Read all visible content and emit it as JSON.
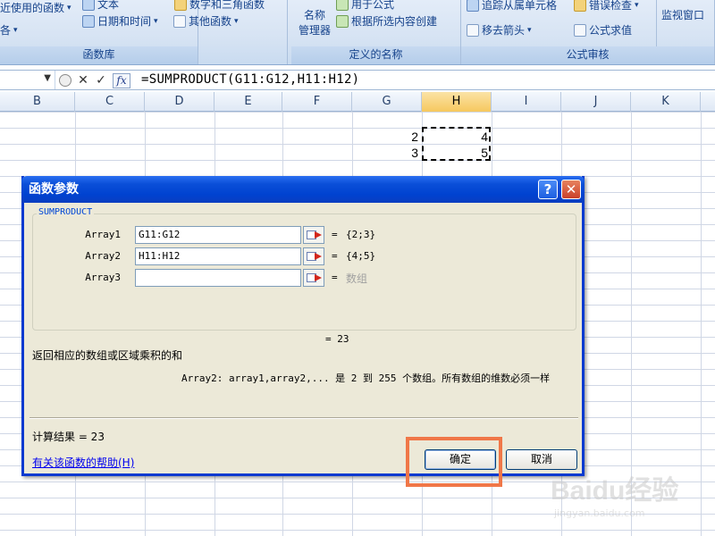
{
  "ribbon": {
    "groups": [
      {
        "label": "函数库",
        "items": [
          "近使用的函数",
          "文本",
          "日期和时间",
          "数字和三角函数",
          "其他函数",
          "各"
        ]
      },
      {
        "label": "定义的名称",
        "items": [
          "名称",
          "管理器",
          "用于公式",
          "根据所选内容创建"
        ]
      },
      {
        "label": "公式审核",
        "items": [
          "追踪从属单元格",
          "错误检查",
          "移去箭头",
          "公式求值"
        ]
      },
      {
        "label": "",
        "items": [
          "监视窗口"
        ]
      }
    ]
  },
  "formula_bar": {
    "formula": "=SUMPRODUCT(G11:G12,H11:H12)",
    "fx_label": "fx"
  },
  "columns": [
    "B",
    "C",
    "D",
    "E",
    "F",
    "G",
    "H",
    "I",
    "J",
    "K"
  ],
  "cells": [
    {
      "col": "G",
      "value": "2"
    },
    {
      "col": "H",
      "value": "4"
    },
    {
      "col": "G",
      "value": "3"
    },
    {
      "col": "H",
      "value": "5"
    }
  ],
  "dialog": {
    "title": "函数参数",
    "help_button": "?",
    "close_button": "✕",
    "function_name": "SUMPRODUCT",
    "args": [
      {
        "label": "Array1",
        "value": "G11:G12",
        "result": "{2;3}"
      },
      {
        "label": "Array2",
        "value": "H11:H12",
        "result": "{4;5}"
      },
      {
        "label": "Array3",
        "value": "",
        "result": "数组"
      }
    ],
    "equals": "=",
    "result_line": "=  23",
    "description": "返回相应的数组或区域乘积的和",
    "arg_description": "Array2:  array1,array2,... 是 2 到 255 个数组。所有数组的维数必须一样",
    "calc_result": "计算结果 =  23",
    "help_link": "有关该函数的帮助(H)",
    "ok_label": "确定",
    "cancel_label": "取消"
  },
  "watermark": {
    "brand": "Baidu经验",
    "url": "jingyan.baidu.com"
  }
}
